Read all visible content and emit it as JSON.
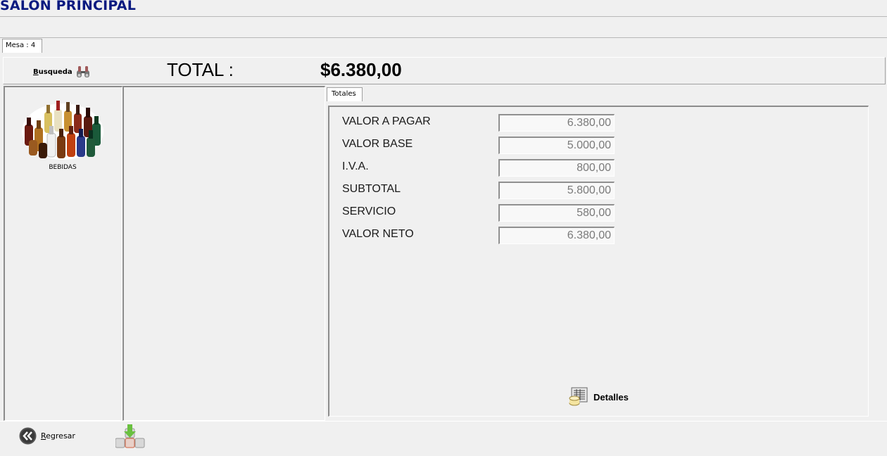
{
  "window": {
    "title": "SALON PRINCIPAL"
  },
  "tabs": {
    "mesa": "Mesa : 4",
    "totales": "Totales"
  },
  "header": {
    "search_key": "B",
    "search_rest": "usqueda",
    "total_label": "TOTAL :",
    "total_value": "$6.380,00"
  },
  "categories": [
    {
      "label": "BEBIDAS",
      "icon": "bottles-icon"
    }
  ],
  "totals": [
    {
      "label": "VALOR A PAGAR",
      "value": "6.380,00"
    },
    {
      "label": "VALOR BASE",
      "value": "5.000,00"
    },
    {
      "label": "I.V.A.",
      "value": "800,00"
    },
    {
      "label": "SUBTOTAL",
      "value": "5.800,00"
    },
    {
      "label": "SERVICIO",
      "value": "580,00"
    },
    {
      "label": "VALOR NETO",
      "value": "6.380,00"
    }
  ],
  "buttons": {
    "detalles": "Detalles",
    "regresar_key": "R",
    "regresar_rest": "egresar"
  },
  "colors": {
    "title": "#0a1a80",
    "background": "#f0f0f0"
  }
}
